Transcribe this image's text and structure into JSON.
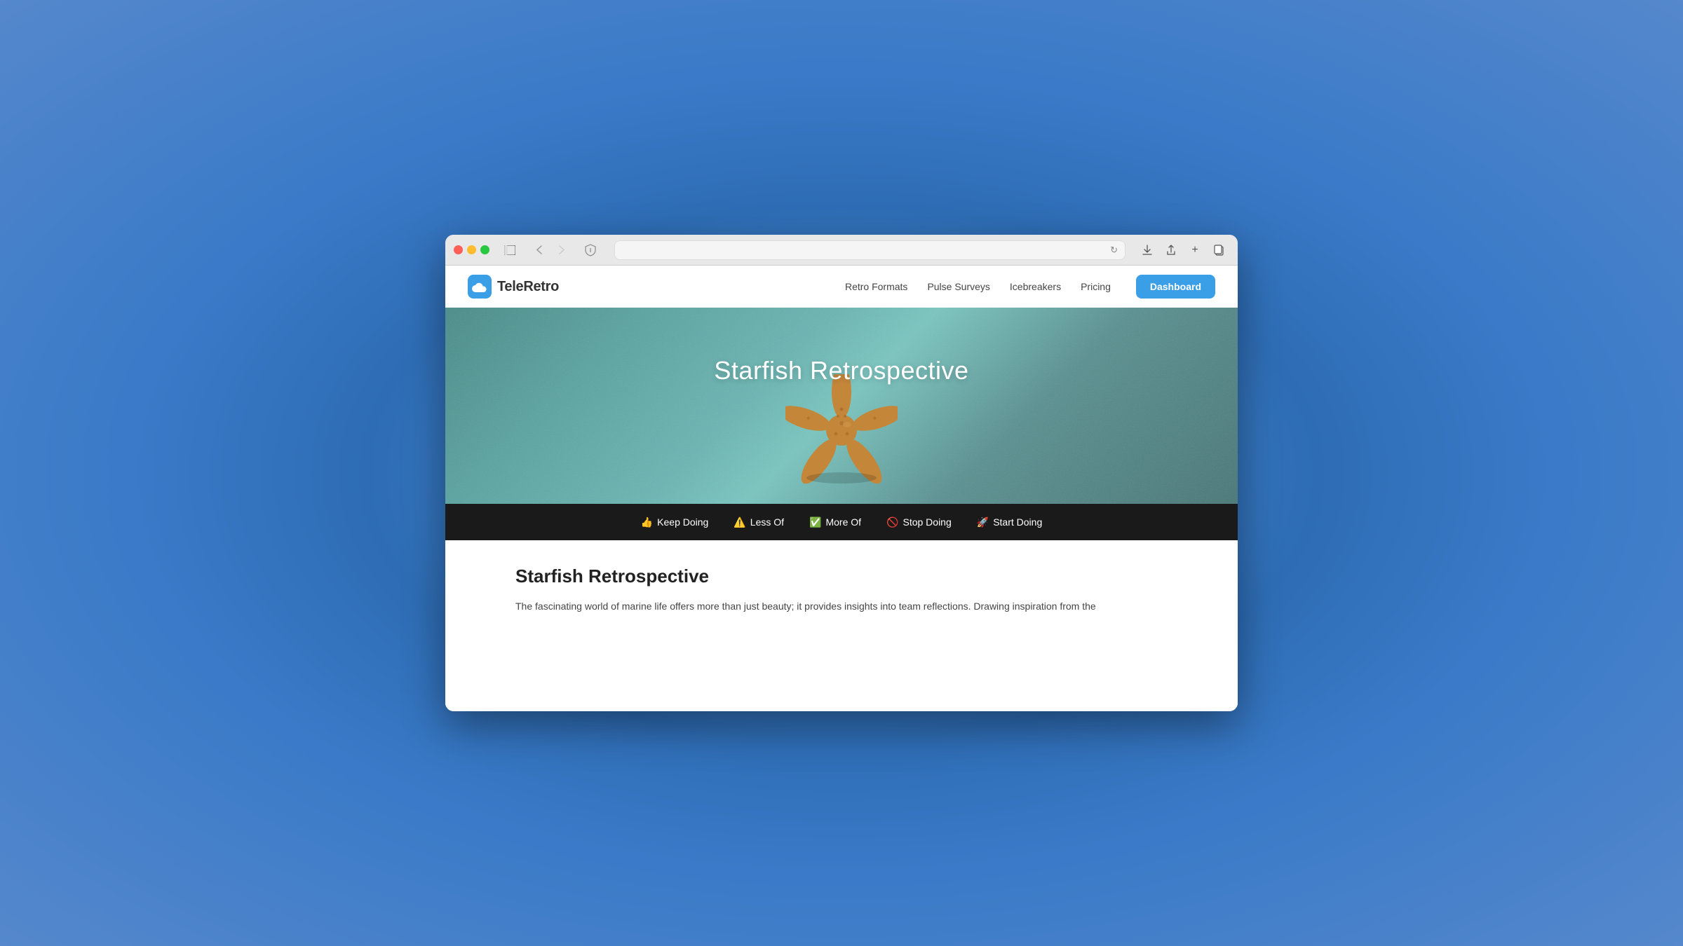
{
  "browser": {
    "address": "",
    "address_placeholder": ""
  },
  "nav": {
    "logo_text": "TeleRetro",
    "links": [
      {
        "label": "Retro Formats",
        "id": "retro-formats"
      },
      {
        "label": "Pulse Surveys",
        "id": "pulse-surveys"
      },
      {
        "label": "Icebreakers",
        "id": "icebreakers"
      },
      {
        "label": "Pricing",
        "id": "pricing"
      }
    ],
    "dashboard_label": "Dashboard"
  },
  "hero": {
    "title": "Starfish Retrospective"
  },
  "categories": [
    {
      "emoji": "👍",
      "label": "Keep Doing"
    },
    {
      "emoji": "⚠️",
      "label": "Less Of"
    },
    {
      "emoji": "✅",
      "label": "More Of"
    },
    {
      "emoji": "🚫",
      "label": "Stop Doing"
    },
    {
      "emoji": "🚀",
      "label": "Start Doing"
    }
  ],
  "content": {
    "title": "Starfish Retrospective",
    "text": "The fascinating world of marine life offers more than just beauty; it provides insights into team reflections. Drawing inspiration from the"
  }
}
